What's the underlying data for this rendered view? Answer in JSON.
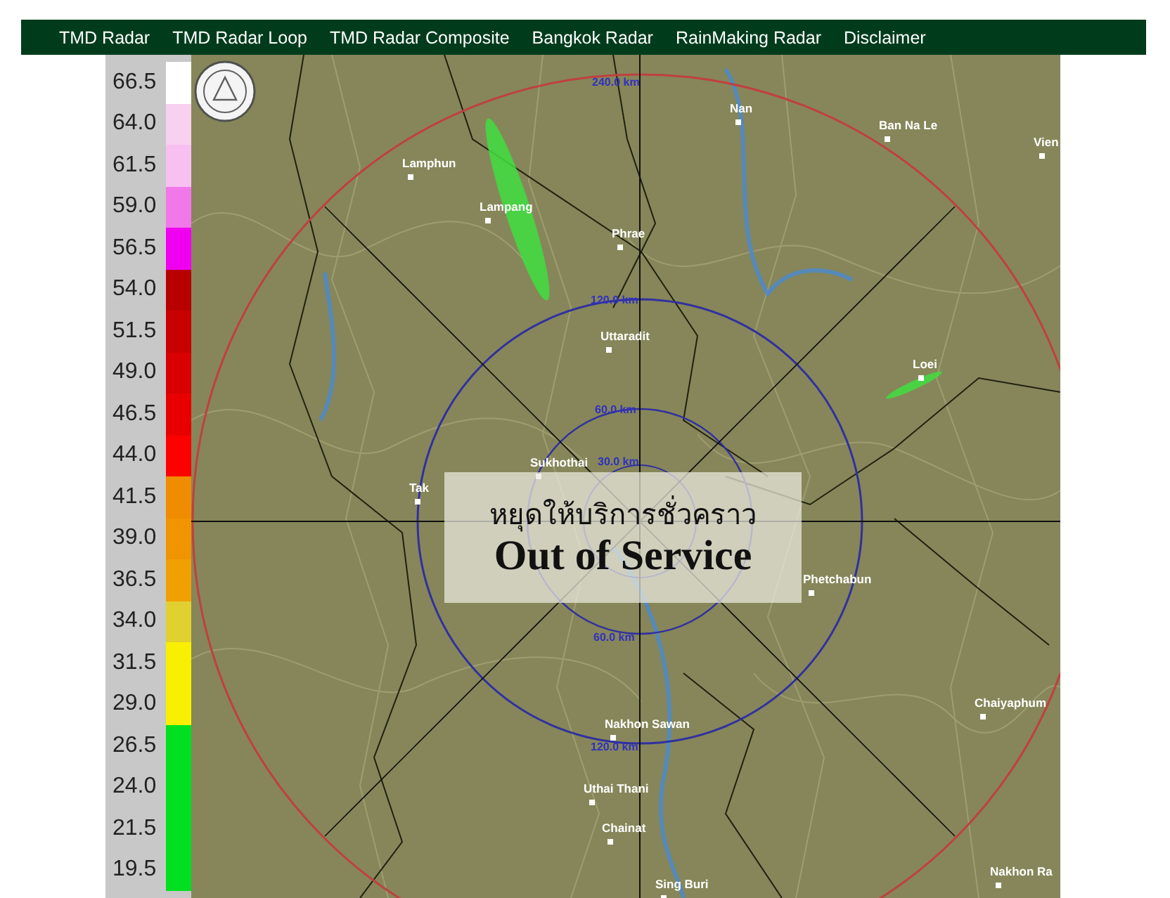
{
  "nav": [
    {
      "label": "TMD Radar"
    },
    {
      "label": "TMD Radar Loop"
    },
    {
      "label": "TMD Radar Composite"
    },
    {
      "label": "Bangkok Radar"
    },
    {
      "label": "RainMaking Radar"
    },
    {
      "label": "Disclaimer"
    }
  ],
  "legend": [
    {
      "value": "66.5",
      "color": "#ffffff"
    },
    {
      "value": "64.0",
      "color": "#f8d0f0"
    },
    {
      "value": "61.5",
      "color": "#f8c0f0"
    },
    {
      "value": "59.0",
      "color": "#f078e8"
    },
    {
      "value": "56.5",
      "color": "#f000f0"
    },
    {
      "value": "54.0",
      "color": "#b80000"
    },
    {
      "value": "51.5",
      "color": "#c80000"
    },
    {
      "value": "49.0",
      "color": "#d80000"
    },
    {
      "value": "46.5",
      "color": "#e80000"
    },
    {
      "value": "44.0",
      "color": "#ff0000"
    },
    {
      "value": "41.5",
      "color": "#f08c00"
    },
    {
      "value": "39.0",
      "color": "#f09400"
    },
    {
      "value": "36.5",
      "color": "#f0a000"
    },
    {
      "value": "34.0",
      "color": "#e0d030"
    },
    {
      "value": "31.5",
      "color": "#f8f000"
    },
    {
      "value": "29.0",
      "color": "#f8f000"
    },
    {
      "value": "26.5",
      "color": "#00e020"
    },
    {
      "value": "24.0",
      "color": "#00e020"
    },
    {
      "value": "21.5",
      "color": "#00e020"
    },
    {
      "value": "19.5",
      "color": "#00e020"
    }
  ],
  "radar": {
    "range_labels": [
      "240.0 km",
      "120.0 km",
      "60.0 km",
      "30.0 km",
      "60.0 km",
      "120.0 km"
    ],
    "towns": [
      "Lamphun",
      "Lampang",
      "Phrae",
      "Nan",
      "Ban Na Le",
      "Vien",
      "Uttaradit",
      "Loei",
      "Sukhothai",
      "Tak",
      "Phetchabun",
      "Chaiyaphum",
      "Nakhon Sawan",
      "Uthai Thani",
      "Chainat",
      "Sing Buri",
      "Nakhon Ra"
    ],
    "banner": {
      "thai_text": "หยุดให้บริการชั่วคราว",
      "english_text": "Out of Service"
    }
  }
}
